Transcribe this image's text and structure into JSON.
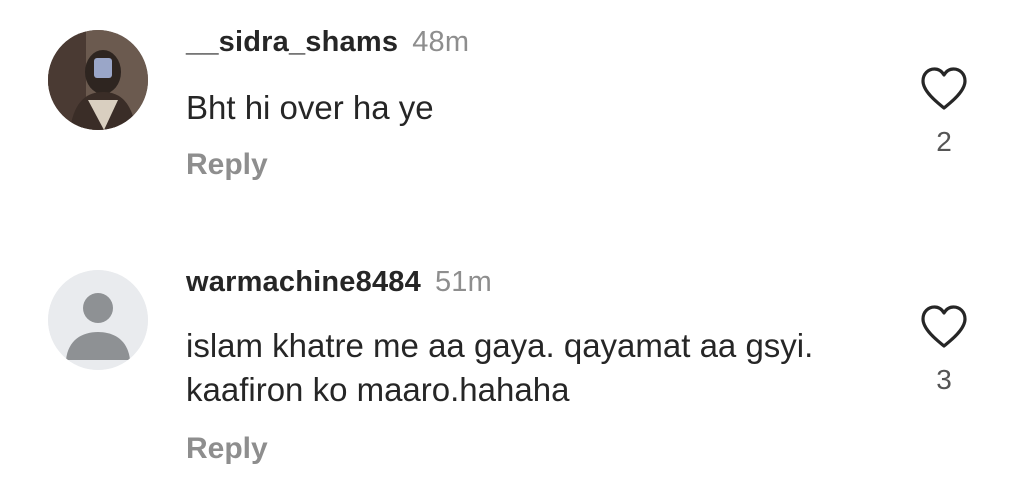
{
  "comments": [
    {
      "username": "__sidra_shams",
      "time": "48m",
      "text": "Bht hi over ha ye",
      "reply_label": "Reply",
      "like_count": "2",
      "avatar": "user-photo-avatar"
    },
    {
      "username": "warmachine8484",
      "time": "51m",
      "text": "islam khatre me aa gaya. qayamat aa gsyi.  kaafiron ko maaro.hahaha",
      "reply_label": "Reply",
      "like_count": "3",
      "avatar": "default-profile-avatar"
    }
  ],
  "colors": {
    "text_primary": "#262626",
    "text_secondary": "#8e8e8e",
    "background": "#ffffff"
  }
}
